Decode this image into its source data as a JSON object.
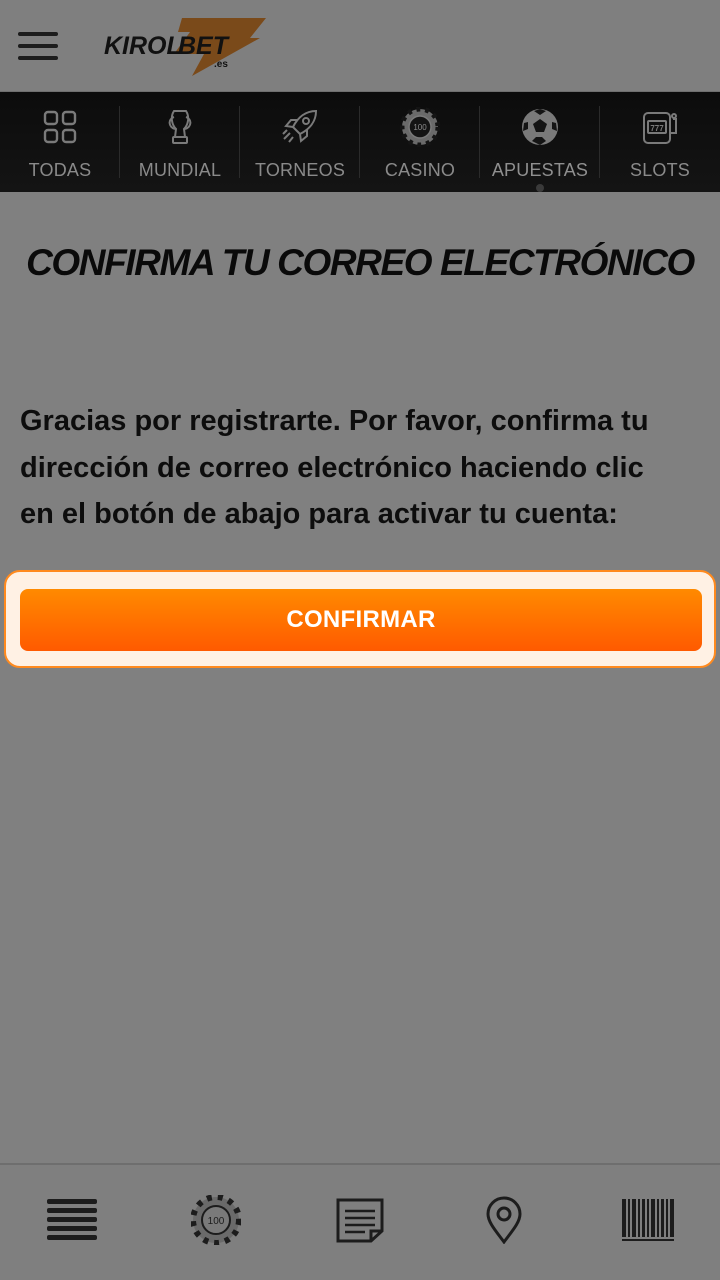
{
  "header": {
    "menu_icon": "hamburger-menu-icon",
    "logo": {
      "brand_left": "KIROL",
      "brand_right": "BET",
      "suffix": ".es",
      "accent": "#ff7a00"
    }
  },
  "categories": [
    {
      "label": "TODAS",
      "icon": "grid-icon"
    },
    {
      "label": "MUNDIAL",
      "icon": "trophy-icon"
    },
    {
      "label": "TORNEOS",
      "icon": "rocket-icon"
    },
    {
      "label": "CASINO",
      "icon": "casino-chip-icon",
      "chip_text": "100"
    },
    {
      "label": "APUESTAS",
      "icon": "soccer-ball-icon"
    },
    {
      "label": "SLOTS",
      "icon": "slot-machine-icon",
      "slot_text": "777"
    }
  ],
  "main": {
    "title": "CONFIRMA TU CORREO ELECTRÓNICO",
    "message_lines": [
      "Gracias por registrarte. Por favor, confirma tu",
      "dirección de correo electrónico haciendo clic",
      "en el botón de abajo para activar tu cuenta:"
    ],
    "confirm_label": "CONFIRMAR"
  },
  "bottom_nav": [
    {
      "icon": "menu-lines-icon"
    },
    {
      "icon": "casino-chip-icon",
      "chip_text": "100"
    },
    {
      "icon": "betslip-icon"
    },
    {
      "icon": "location-pin-icon"
    },
    {
      "icon": "barcode-icon"
    }
  ],
  "colors": {
    "accent": "#ff7a00",
    "overlay": "#808080",
    "nav_bg": "#0c0c0c"
  }
}
